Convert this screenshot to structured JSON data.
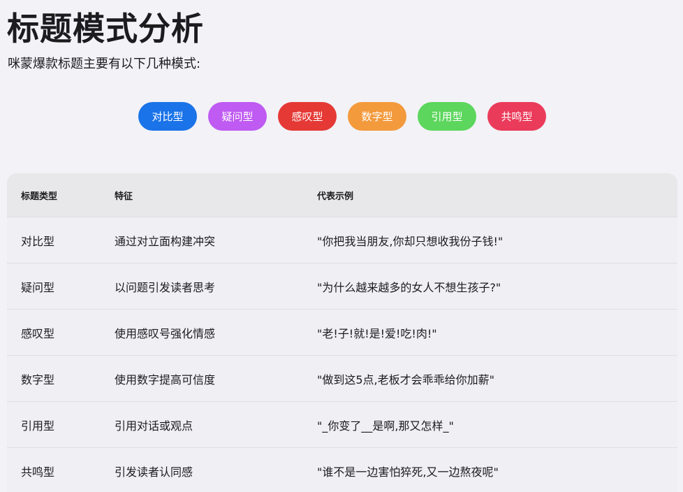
{
  "header": {
    "title": "标题模式分析",
    "subtitle": "咪蒙爆款标题主要有以下几种模式:"
  },
  "pills": [
    {
      "label": "对比型",
      "color": "#1a73e8"
    },
    {
      "label": "疑问型",
      "color": "#bf5af2"
    },
    {
      "label": "感叹型",
      "color": "#e53935"
    },
    {
      "label": "数字型",
      "color": "#f39a3d"
    },
    {
      "label": "引用型",
      "color": "#5cd65c"
    },
    {
      "label": "共鸣型",
      "color": "#eb3b5a"
    }
  ],
  "table": {
    "headers": [
      "标题类型",
      "特征",
      "代表示例"
    ],
    "rows": [
      [
        "对比型",
        "通过对立面构建冲突",
        "\"你把我当朋友,你却只想收我份子钱!\""
      ],
      [
        "疑问型",
        "以问题引发读者思考",
        "\"为什么越来越多的女人不想生孩子?\""
      ],
      [
        "感叹型",
        "使用感叹号强化情感",
        "\"老!子!就!是!爱!吃!肉!\""
      ],
      [
        "数字型",
        "使用数字提高可信度",
        "\"做到这5点,老板才会乖乖给你加薪\""
      ],
      [
        "引用型",
        "引用对话或观点",
        "\"_你变了__是啊,那又怎样_\""
      ],
      [
        "共鸣型",
        "引发读者认同感",
        "\"谁不是一边害怕猝死,又一边熬夜呢\""
      ]
    ]
  }
}
